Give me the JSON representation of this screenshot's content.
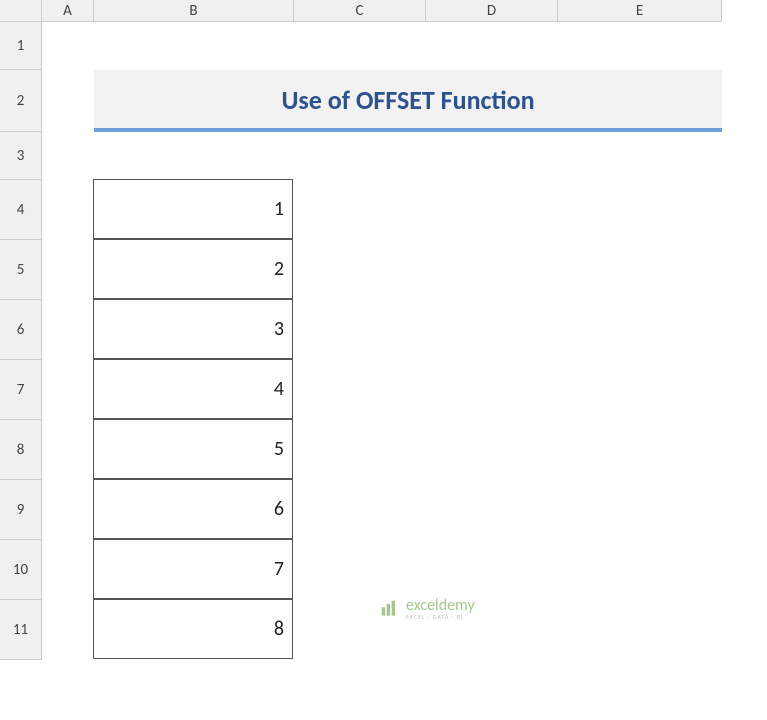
{
  "columns": {
    "A": "A",
    "B": "B",
    "C": "C",
    "D": "D",
    "E": "E"
  },
  "row_headers": {
    "1": "1",
    "2": "2",
    "3": "3",
    "4": "4",
    "5": "5",
    "6": "6",
    "7": "7",
    "8": "8",
    "9": "9",
    "10": "10",
    "11": "11"
  },
  "title": "Use of OFFSET Function",
  "chart_data": {
    "type": "table",
    "title": "Use of OFFSET Function",
    "column_B_values": [
      1,
      2,
      3,
      4,
      5,
      6,
      7,
      8
    ]
  },
  "watermark": {
    "brand": "exceldemy",
    "tagline": "EXCEL · DATA · BI"
  }
}
